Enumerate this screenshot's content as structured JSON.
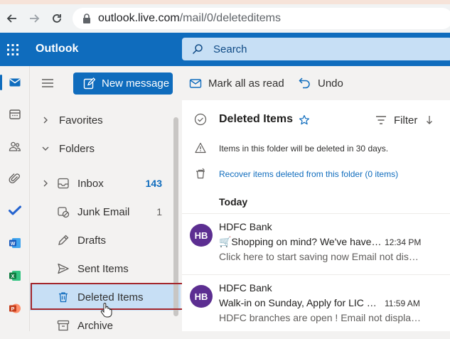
{
  "browser": {
    "url_host": "outlook.live.com",
    "url_path": "/mail/0/deleteditems"
  },
  "header": {
    "brand": "Outlook",
    "search_placeholder": "Search",
    "accent": "#0f6cbd"
  },
  "rail": {
    "items": [
      "mail-icon",
      "calendar-icon",
      "people-icon",
      "attach-icon",
      "todo-icon",
      "word-icon",
      "excel-icon",
      "powerpoint-icon"
    ]
  },
  "toolbar": {
    "new_message": "New message",
    "mark_all_read": "Mark all as read",
    "undo": "Undo"
  },
  "folders": {
    "favorites": "Favorites",
    "folders": "Folders",
    "items": [
      {
        "label": "Inbox",
        "count": "143"
      },
      {
        "label": "Junk Email",
        "count": "1"
      },
      {
        "label": "Drafts",
        "count": ""
      },
      {
        "label": "Sent Items",
        "count": ""
      },
      {
        "label": "Deleted Items",
        "count": ""
      },
      {
        "label": "Archive",
        "count": ""
      }
    ]
  },
  "pane": {
    "title": "Deleted Items",
    "filter": "Filter",
    "notice": "Items in this folder will be deleted in 30 days.",
    "recover": "Recover items deleted from this folder (0 items)",
    "group": "Today",
    "messages": [
      {
        "initials": "HB",
        "sender": "HDFC Bank",
        "subject": "🛒Shopping on mind? We've have got you covered",
        "time": "12:34 PM",
        "preview": "Click here to start saving now Email not displaying correctly?"
      },
      {
        "initials": "HB",
        "sender": "HDFC Bank",
        "subject": "Walk-in on Sunday, Apply for LIC Policy",
        "time": "11:59 AM",
        "preview": "HDFC branches are open ! Email not displaying correctly?"
      }
    ]
  }
}
